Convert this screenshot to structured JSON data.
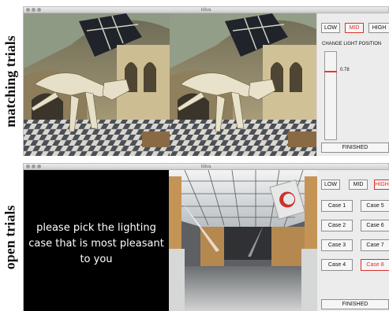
{
  "labels": {
    "top": "matching trials",
    "bottom": "open trials"
  },
  "window_top": {
    "title": "Idiva",
    "buttons": {
      "low": "LOW",
      "mid": "MID",
      "high": "HIGH"
    },
    "caption": "CHANGE LIGHT POSITION",
    "slider_value_text": "0.78",
    "slider_level": 0.78,
    "finished": "FINISHED"
  },
  "window_bottom": {
    "title": "Idiva",
    "buttons": {
      "low": "LOW",
      "mid": "MID",
      "high": "HIGH"
    },
    "prompt": "please pick the lighting case that is most pleasant to you",
    "cases": [
      "Case 1",
      "Case 2",
      "Case 3",
      "Case 4",
      "Case 5",
      "Case 6",
      "Case 7",
      "Case 8"
    ],
    "selected_case": "Case 8",
    "finished": "FINISHED"
  },
  "colors": {
    "accent": "#d9322b",
    "panel": "#ececec",
    "window": "#d8d8d8"
  }
}
